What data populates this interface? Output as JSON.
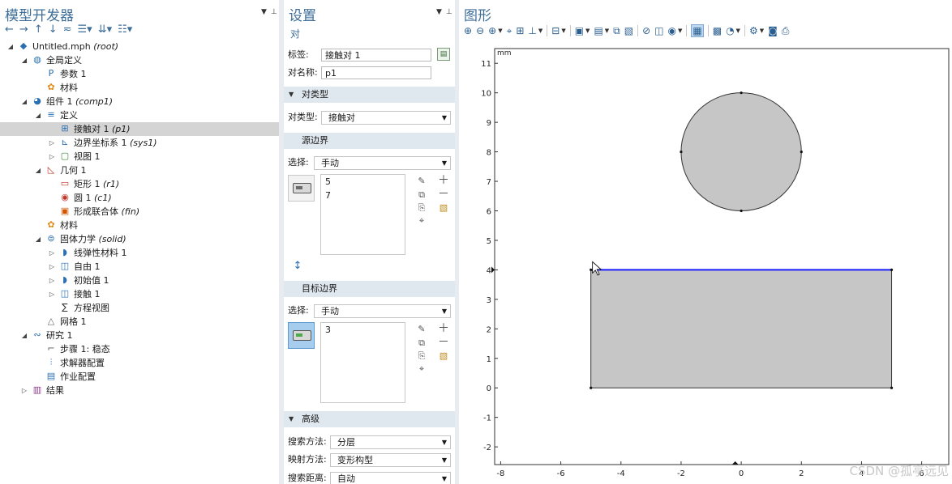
{
  "model_builder": {
    "title": "模型开发器",
    "tree": [
      {
        "label": "Untitled.mph",
        "tag": "(root)",
        "icon": "file-icon",
        "toggle": "▲"
      },
      {
        "label": "全局定义",
        "tag": "",
        "icon": "globe-icon",
        "toggle": "▲"
      },
      {
        "label": "参数 1",
        "tag": "",
        "icon": "parameters-icon",
        "toggle": ""
      },
      {
        "label": "材料",
        "tag": "",
        "icon": "materials-icon",
        "toggle": ""
      },
      {
        "label": "组件 1",
        "tag": "(comp1)",
        "icon": "component-icon",
        "toggle": "▲"
      },
      {
        "label": "定义",
        "tag": "",
        "icon": "definitions-icon",
        "toggle": "▲"
      },
      {
        "label": "接触对 1",
        "tag": "(p1)",
        "icon": "pair-icon",
        "toggle": "",
        "selected": true
      },
      {
        "label": "边界坐标系 1",
        "tag": "(sys1)",
        "icon": "coordinate-system-icon",
        "toggle": "▷"
      },
      {
        "label": "视图 1",
        "tag": "",
        "icon": "view-icon",
        "toggle": "▷"
      },
      {
        "label": "几何 1",
        "tag": "",
        "icon": "geometry-icon",
        "toggle": "▲"
      },
      {
        "label": "矩形 1",
        "tag": "(r1)",
        "icon": "rectangle-icon",
        "toggle": ""
      },
      {
        "label": "圆 1",
        "tag": "(c1)",
        "icon": "circle-icon",
        "toggle": ""
      },
      {
        "label": "形成联合体",
        "tag": "(fin)",
        "icon": "form-union-icon",
        "toggle": ""
      },
      {
        "label": "材料",
        "tag": "",
        "icon": "materials-icon",
        "toggle": ""
      },
      {
        "label": "固体力学",
        "tag": "(solid)",
        "icon": "solid-mechanics-icon",
        "toggle": "▲"
      },
      {
        "label": "线弹性材料 1",
        "tag": "",
        "icon": "linear-elastic-icon",
        "toggle": "▷"
      },
      {
        "label": "自由 1",
        "tag": "",
        "icon": "free-icon",
        "toggle": "▷"
      },
      {
        "label": "初始值 1",
        "tag": "",
        "icon": "initial-values-icon",
        "toggle": "▷"
      },
      {
        "label": "接触 1",
        "tag": "",
        "icon": "contact-icon",
        "toggle": "▷"
      },
      {
        "label": "方程视图",
        "tag": "",
        "icon": "equation-view-icon",
        "toggle": ""
      },
      {
        "label": "网格 1",
        "tag": "",
        "icon": "mesh-icon",
        "toggle": ""
      },
      {
        "label": "研究 1",
        "tag": "",
        "icon": "study-icon",
        "toggle": "▲"
      },
      {
        "label": "步骤 1: 稳态",
        "tag": "",
        "icon": "stationary-step-icon",
        "toggle": ""
      },
      {
        "label": "求解器配置",
        "tag": "",
        "icon": "solver-config-icon",
        "toggle": ""
      },
      {
        "label": "作业配置",
        "tag": "",
        "icon": "job-config-icon",
        "toggle": ""
      },
      {
        "label": "结果",
        "tag": "",
        "icon": "results-icon",
        "toggle": "▷"
      }
    ]
  },
  "settings": {
    "title": "设置",
    "subtitle": "对",
    "label_caption": "标签:",
    "label_value": "接触对 1",
    "name_caption": "对名称:",
    "name_value": "p1",
    "pair_type_section": "对类型",
    "pair_type_caption": "对类型:",
    "pair_type_value": "接触对",
    "source_section": "源边界",
    "select_caption": "选择:",
    "source_select_value": "手动",
    "source_items": [
      "5",
      "7"
    ],
    "dest_section": "目标边界",
    "dest_select_value": "手动",
    "dest_items": [
      "3"
    ],
    "advanced_section": "高级",
    "search_method_caption": "搜索方法:",
    "search_method_value": "分层",
    "mapping_method_caption": "映射方法:",
    "mapping_method_value": "变形构型",
    "search_distance_caption": "搜索距离:",
    "search_distance_value": "自动"
  },
  "graphics": {
    "title": "图形",
    "unit": "mm",
    "watermark": "CSDN @孤亭远见"
  },
  "chart_data": {
    "type": "geometry",
    "x_ticks": [
      "-8",
      "-6",
      "-4",
      "-2",
      "0",
      "2",
      "4",
      "6"
    ],
    "y_ticks": [
      "11",
      "10",
      "9",
      "8",
      "7",
      "6",
      "5",
      "4",
      "3",
      "2",
      "1",
      "0",
      "-1",
      "-2"
    ],
    "xlim": [
      -8.2,
      6.9
    ],
    "ylim": [
      -2.6,
      11.5
    ],
    "rectangle": {
      "x0": -5,
      "y0": 0,
      "x1": 5,
      "y1": 4
    },
    "circle": {
      "cx": 0,
      "cy": 8,
      "r": 2
    },
    "highlight_edge": {
      "x0": -5,
      "y0": 4,
      "x1": 5,
      "y1": 4,
      "color": "#1a1aff"
    },
    "fill_color": "#c6c6c6"
  }
}
